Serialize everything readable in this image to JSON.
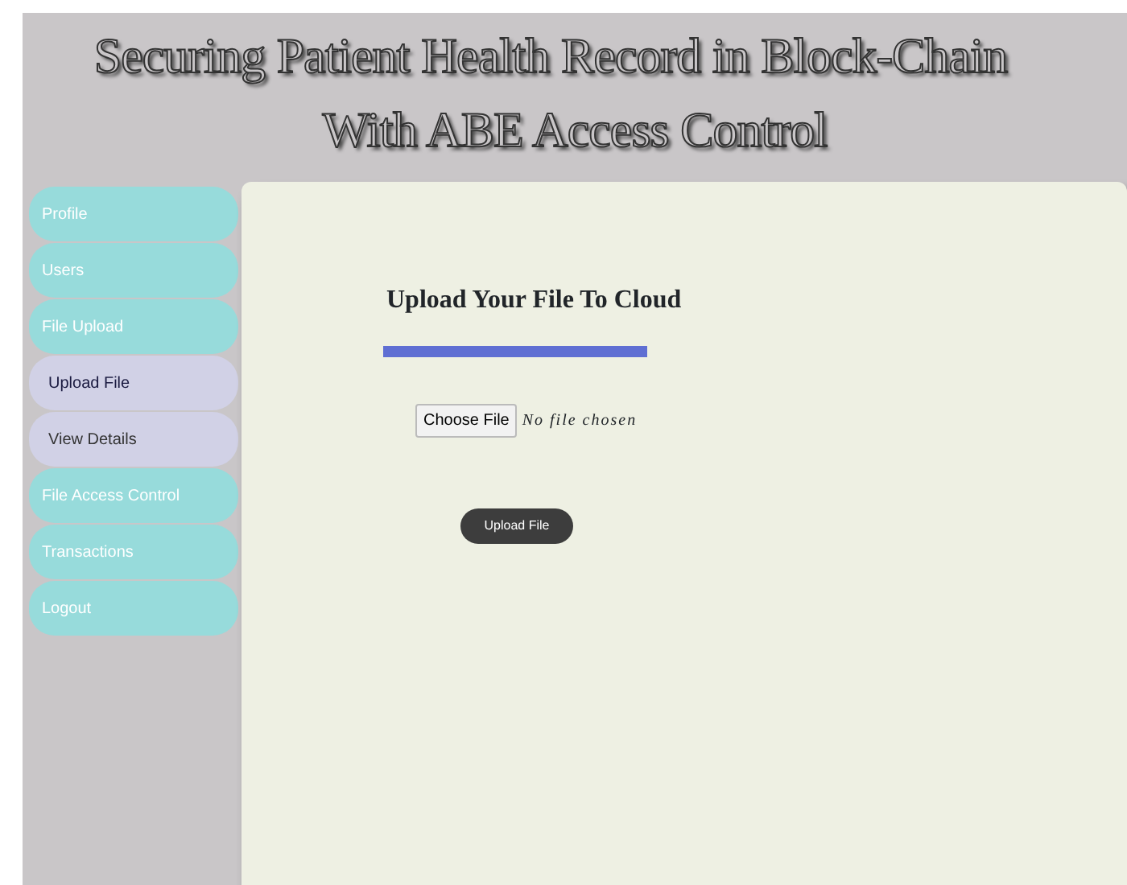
{
  "header": {
    "title_line_1": "Securing Patient Health Record in Block-Chain",
    "title_line_2": "With ABE Access Control"
  },
  "sidebar": {
    "items": [
      {
        "label": "Profile"
      },
      {
        "label": "Users"
      },
      {
        "label": "File Upload",
        "children": [
          {
            "label": "Upload File",
            "selected": true
          },
          {
            "label": "View Details",
            "selected": false
          }
        ]
      },
      {
        "label": "File Access Control"
      },
      {
        "label": "Transactions"
      },
      {
        "label": "Logout"
      }
    ]
  },
  "content": {
    "heading": "Upload Your File To Cloud",
    "file_button": "Choose File",
    "file_status": "No file chosen",
    "submit": "Upload File"
  }
}
